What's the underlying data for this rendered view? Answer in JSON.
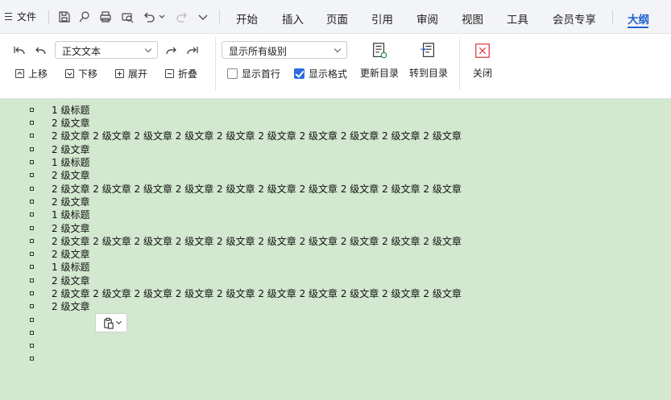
{
  "menubar": {
    "file_label": "文件",
    "tabs": [
      {
        "label": "开始"
      },
      {
        "label": "插入"
      },
      {
        "label": "页面"
      },
      {
        "label": "引用"
      },
      {
        "label": "审阅"
      },
      {
        "label": "视图"
      },
      {
        "label": "工具"
      },
      {
        "label": "会员专享"
      },
      {
        "label": "大纲"
      }
    ],
    "active_tab": "大纲",
    "quick_access_icons": [
      "save-icon",
      "format-painter-icon",
      "print-icon",
      "print-preview-icon",
      "undo-icon",
      "redo-icon",
      "more-icon"
    ]
  },
  "ribbon": {
    "level_select": "正文文本",
    "move_up_label": "上移",
    "move_down_label": "下移",
    "expand_label": "展开",
    "collapse_label": "折叠",
    "show_levels_select": "显示所有级别",
    "show_first_line_label": "显示首行",
    "show_first_line_checked": false,
    "show_format_label": "显示格式",
    "show_format_checked": true,
    "update_toc_label": "更新目录",
    "goto_toc_label": "转到目录",
    "close_label": "关闭"
  },
  "outline": [
    "1 级标题",
    "2 级文章",
    "2 级文章 2 级文章 2 级文章 2 级文章 2 级文章 2 级文章 2 级文章 2 级文章 2 级文章 2 级文章",
    "2 级文章",
    "1 级标题",
    "2 级文章",
    "2 级文章 2 级文章 2 级文章 2 级文章 2 级文章 2 级文章 2 级文章 2 级文章 2 级文章 2 级文章",
    "2 级文章",
    "1 级标题",
    "2 级文章",
    "2 级文章 2 级文章 2 级文章 2 级文章 2 级文章 2 级文章 2 级文章 2 级文章 2 级文章 2 级文章",
    "2 级文章",
    "1 级标题",
    "2 级文章",
    "2 级文章 2 级文章 2 级文章 2 级文章 2 级文章 2 级文章 2 级文章 2 级文章 2 级文章 2 级文章",
    "2 级文章",
    "",
    "",
    "",
    "",
    ""
  ],
  "colors": {
    "page_background": "#d2e8cf",
    "accent": "#1c5fd4"
  }
}
